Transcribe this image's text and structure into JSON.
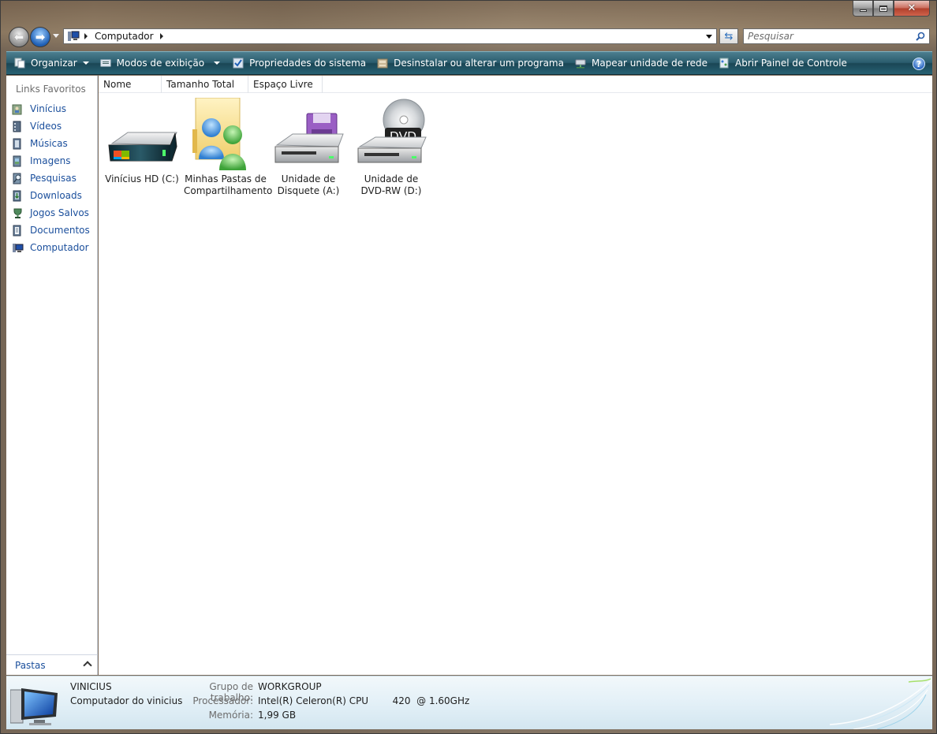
{
  "address": {
    "segments": [
      "Computador"
    ]
  },
  "search": {
    "placeholder": "Pesquisar"
  },
  "toolbar": {
    "organize": "Organizar",
    "views": "Modos de exibição",
    "system_properties": "Propriedades do sistema",
    "uninstall": "Desinstalar ou alterar um programa",
    "map_drive": "Mapear unidade de rede",
    "control_panel": "Abrir Painel de Controle"
  },
  "favorites": {
    "heading": "Links Favoritos",
    "items": [
      {
        "label": "Vinícius",
        "icon": "user-folder-icon"
      },
      {
        "label": "Vídeos",
        "icon": "videos-icon"
      },
      {
        "label": "Músicas",
        "icon": "music-icon"
      },
      {
        "label": "Imagens",
        "icon": "pictures-icon"
      },
      {
        "label": "Pesquisas",
        "icon": "searches-icon"
      },
      {
        "label": "Downloads",
        "icon": "downloads-icon"
      },
      {
        "label": "Jogos Salvos",
        "icon": "saved-games-icon"
      },
      {
        "label": "Documentos",
        "icon": "documents-icon"
      },
      {
        "label": "Computador",
        "icon": "computer-icon"
      }
    ],
    "folders_label": "Pastas"
  },
  "columns": [
    "Nome",
    "Tamanho Total",
    "Espaço Livre"
  ],
  "items": [
    {
      "line1": "Vinícius HD (C:)",
      "line2": "",
      "icon": "hard-drive-icon"
    },
    {
      "line1": "Minhas Pastas de",
      "line2": "Compartilhamento",
      "icon": "shared-folders-icon"
    },
    {
      "line1": "Unidade de",
      "line2": "Disquete (A:)",
      "icon": "floppy-drive-icon"
    },
    {
      "line1": "Unidade de",
      "line2": "DVD-RW (D:)",
      "icon": "dvd-drive-icon"
    }
  ],
  "details": {
    "computer_name": "VINICIUS",
    "computer_description": "Computador do vinicius",
    "props": [
      {
        "label": "Grupo de trabalho:",
        "value": "WORKGROUP"
      },
      {
        "label": "Processador:",
        "value": "Intel(R) Celeron(R) CPU        420  @ 1.60GHz"
      },
      {
        "label": "Memória:",
        "value": "1,99 GB"
      }
    ]
  },
  "colors": {
    "toolbar": "#2a5c6d",
    "link": "#1b4f9c",
    "details_bg": "#e3f0f7"
  }
}
